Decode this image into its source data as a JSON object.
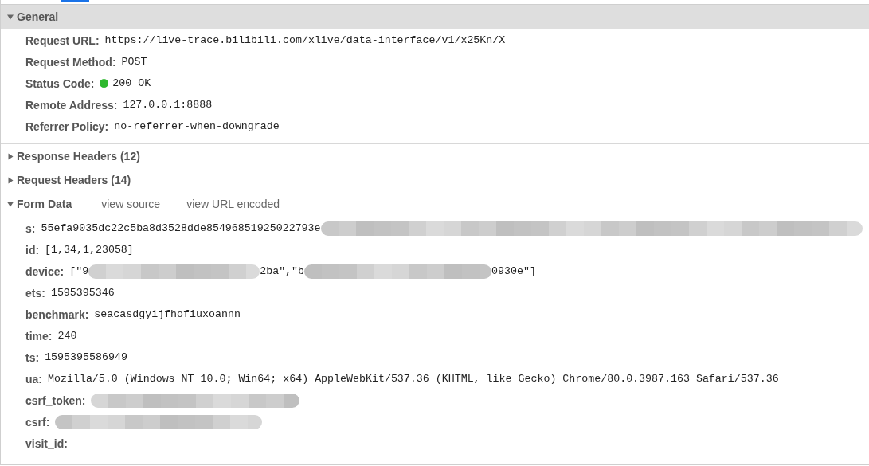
{
  "sections": [
    {
      "kind": "general",
      "title": "General",
      "expanded": true,
      "rows": [
        {
          "label": "Request URL:",
          "value": [
            {
              "kind": "text",
              "text": "https://live-trace.bilibili.com/xlive/data-interface/v1/x25Kn/X"
            }
          ]
        },
        {
          "label": "Request Method:",
          "value": [
            {
              "kind": "text",
              "text": "POST"
            }
          ]
        },
        {
          "label": "Status Code:",
          "value": [
            {
              "kind": "status",
              "color": "#2eb82e"
            },
            {
              "kind": "text",
              "text": "200 OK"
            }
          ]
        },
        {
          "label": "Remote Address:",
          "value": [
            {
              "kind": "text",
              "text": "127.0.0.1:8888"
            }
          ]
        },
        {
          "label": "Referrer Policy:",
          "value": [
            {
              "kind": "text",
              "text": "no-referrer-when-downgrade"
            }
          ]
        }
      ]
    },
    {
      "kind": "plain",
      "title": "Response Headers (12)",
      "expanded": false
    },
    {
      "kind": "plain",
      "title": "Request Headers (14)",
      "expanded": false
    },
    {
      "kind": "plain",
      "title": "Form Data",
      "expanded": true,
      "links": [
        "view source",
        "view URL encoded"
      ],
      "rows": [
        {
          "label": "s:",
          "value": [
            {
              "kind": "text",
              "text": "55efa9035dc22c5ba8d3528dde85496851925022793e"
            },
            {
              "kind": "redaction"
            }
          ]
        },
        {
          "label": "id:",
          "value": [
            {
              "kind": "text",
              "text": "[1,34,1,23058]"
            }
          ]
        },
        {
          "label": "device:",
          "value": [
            {
              "kind": "text",
              "text": "[\"9"
            },
            {
              "kind": "redaction"
            },
            {
              "kind": "text",
              "text": "2ba\",\"b"
            },
            {
              "kind": "redaction"
            },
            {
              "kind": "text",
              "text": "0930e\"]"
            }
          ]
        },
        {
          "label": "ets:",
          "value": [
            {
              "kind": "text",
              "text": "1595395346"
            }
          ]
        },
        {
          "label": "benchmark:",
          "value": [
            {
              "kind": "text",
              "text": "seacasdgyijfhofiuxoannn"
            }
          ]
        },
        {
          "label": "time:",
          "value": [
            {
              "kind": "text",
              "text": "240"
            }
          ]
        },
        {
          "label": "ts:",
          "value": [
            {
              "kind": "text",
              "text": "1595395586949"
            }
          ]
        },
        {
          "label": "ua:",
          "value": [
            {
              "kind": "text",
              "text": "Mozilla/5.0 (Windows NT 10.0; Win64; x64) AppleWebKit/537.36 (KHTML, like Gecko) Chrome/80.0.3987.163 Safari/537.36"
            }
          ]
        },
        {
          "label": "csrf_token:",
          "value": [
            {
              "kind": "redaction"
            }
          ]
        },
        {
          "label": "csrf:",
          "value": [
            {
              "kind": "redaction"
            }
          ]
        },
        {
          "label": "visit_id:",
          "value": []
        }
      ]
    }
  ]
}
